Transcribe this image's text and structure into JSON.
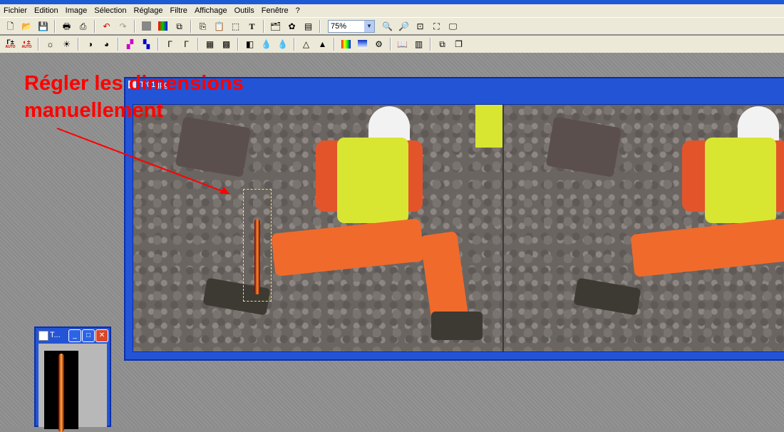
{
  "menubar": {
    "items": [
      "Fichier",
      "Edition",
      "Image",
      "Sélection",
      "Réglage",
      "Filtre",
      "Affichage",
      "Outils",
      "Fenêtre",
      "?"
    ]
  },
  "toolbar": {
    "zoom_value": "75%",
    "row1_icons": [
      "new-file-icon",
      "open-folder-icon",
      "save-icon",
      "print-icon",
      "scan-icon",
      "undo-icon",
      "redo-icon",
      "gray-square-icon",
      "color-grid-icon",
      "capture-icon",
      "copy-icon",
      "paste-icon",
      "select-region-icon",
      "text-icon",
      "tree-icon",
      "flower-icon",
      "window-icon"
    ],
    "row1_after_zoom": [
      "zoom-in-icon",
      "zoom-out-icon",
      "fit-icon",
      "fullscreen-icon",
      "screen-icon"
    ],
    "row2_icons": [
      "auto-levels-icon",
      "auto-contrast-icon",
      "brightness-down-icon",
      "brightness-up-icon",
      "contrast-down-icon",
      "contrast-up-icon",
      "color-down-icon",
      "color-up-icon",
      "gamma-down-icon",
      "gamma-up-icon",
      "grid-icon",
      "grid-alt-icon",
      "split-icon",
      "drop-icon",
      "drop-alt-icon",
      "triangle-icon",
      "triangle-alt-icon",
      "palette-icon",
      "gradient-icon",
      "filter-icon",
      "book-icon",
      "panel-icon",
      "stack-icon",
      "layers-icon"
    ],
    "row2_labels": {
      "auto1": "AUTO",
      "auto2": "AUTO"
    }
  },
  "annotation": {
    "line1": "Régler les dimensions",
    "line2": "manuellement",
    "color": "#ff0000"
  },
  "document_window": {
    "title": "Tr01.jpg"
  },
  "tool_window": {
    "title": "T...",
    "buttons": {
      "minimize": "_",
      "maximize": "□",
      "close": "✕"
    }
  },
  "colors": {
    "title_blue": "#2454d6",
    "menu_bg": "#ece9d8"
  }
}
